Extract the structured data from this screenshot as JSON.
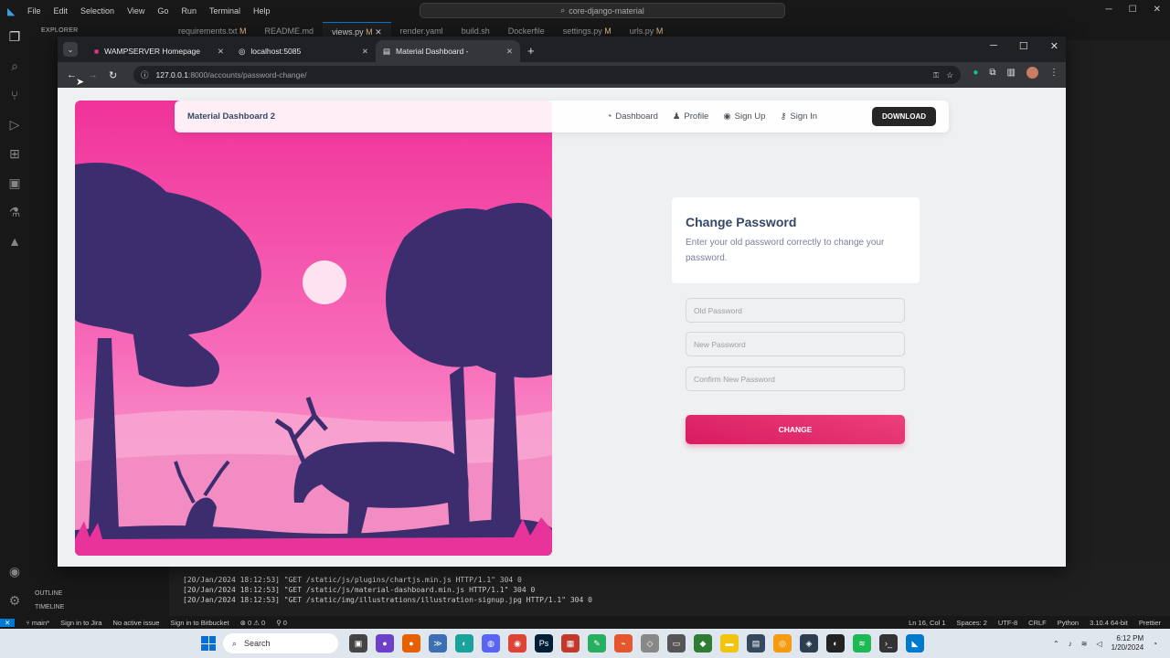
{
  "vscode": {
    "menu": [
      "File",
      "Edit",
      "Selection",
      "View",
      "Go",
      "Run",
      "Terminal",
      "Help"
    ],
    "command_center": "core-django-material",
    "tabs": [
      {
        "label": "requirements.txt",
        "mod": "M"
      },
      {
        "label": "README.md",
        "mod": ""
      },
      {
        "label": "views.py",
        "mod": "M"
      },
      {
        "label": "render.yaml",
        "mod": ""
      },
      {
        "label": "build.sh",
        "mod": ""
      },
      {
        "label": "Dockerfile",
        "mod": ""
      },
      {
        "label": "settings.py",
        "mod": "M"
      },
      {
        "label": "urls.py",
        "mod": "M"
      }
    ],
    "explorer_title": "EXPLORER",
    "outline": "OUTLINE",
    "timeline": "TIMELINE",
    "terminal_lines": [
      "[20/Jan/2024 18:12:53] \"GET /static/js/plugins/chartjs.min.js HTTP/1.1\" 304 0",
      "[20/Jan/2024 18:12:53] \"GET /static/js/material-dashboard.min.js HTTP/1.1\" 304 0",
      "[20/Jan/2024 18:12:53] \"GET /static/img/illustrations/illustration-signup.jpg HTTP/1.1\" 304 0"
    ],
    "status": {
      "branch": "main*",
      "jira": "Sign in to Jira",
      "issue": "No active issue",
      "bitbucket": "Sign in to Bitbucket",
      "problems": "0 ⚠ 0",
      "ports": "0",
      "position": "Ln 16, Col 1",
      "spaces": "Spaces: 2",
      "encoding": "UTF-8",
      "eol": "CRLF",
      "language": "Python",
      "interpreter": "3.10.4 64-bit",
      "prettier": "Prettier"
    }
  },
  "chrome": {
    "tabs": [
      {
        "label": "WAMPSERVER Homepage",
        "active": false
      },
      {
        "label": "localhost:5085",
        "active": false
      },
      {
        "label": "Material Dashboard -",
        "active": true
      }
    ],
    "url_host": "127.0.0.1",
    "url_path": ":8000/accounts/password-change/"
  },
  "page": {
    "brand": "Material Dashboard 2",
    "nav": [
      "Dashboard",
      "Profile",
      "Sign Up",
      "Sign In"
    ],
    "download": "DOWNLOAD",
    "card_title": "Change Password",
    "card_text": "Enter your old password correctly to change your password.",
    "old_password_placeholder": "Old Password",
    "new_password_placeholder": "New Password",
    "confirm_password_placeholder": "Confirm New Password",
    "submit": "CHANGE"
  },
  "taskbar": {
    "search": "Search",
    "time": "6:12 PM",
    "date": "1/20/2024"
  }
}
